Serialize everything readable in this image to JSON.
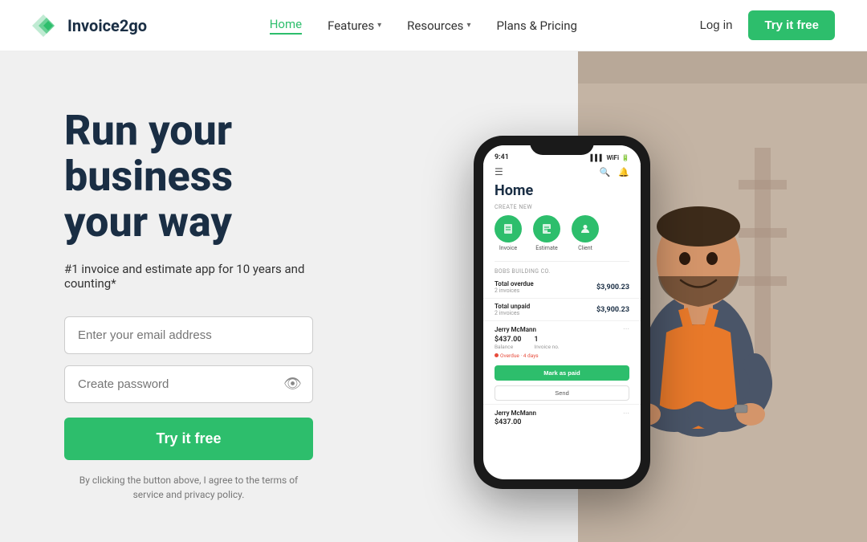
{
  "header": {
    "logo_text": "Invoice2go",
    "nav": {
      "home": "Home",
      "features": "Features",
      "resources": "Resources",
      "plans_pricing": "Plans & Pricing",
      "login": "Log in",
      "try_free": "Try it free"
    }
  },
  "hero": {
    "headline_line1": "Run your",
    "headline_line2": "business",
    "headline_line3": "your way",
    "subtitle": "#1 invoice and estimate app for 10 years and counting*",
    "email_placeholder": "Enter your email address",
    "password_placeholder": "Create password",
    "cta_button": "Try it free",
    "terms": "By clicking the button above, I agree to the terms of service and privacy policy."
  },
  "phone": {
    "status_time": "9:41",
    "home_title": "Home",
    "create_new_label": "CREATE NEW",
    "icons": [
      {
        "label": "Invoice"
      },
      {
        "label": "Estimate"
      },
      {
        "label": "Client"
      }
    ],
    "business_label": "BOBS BUILDING CO.",
    "stats": [
      {
        "title": "Total overdue",
        "sub": "2 invoices",
        "amount": "$3,900.23"
      },
      {
        "title": "Total unpaid",
        "sub": "2 invoices",
        "amount": "$3,900.23"
      }
    ],
    "clients": [
      {
        "name": "Jerry McMann",
        "balance": "$437.00",
        "balance_label": "Balance",
        "invoice_count": "1",
        "invoice_label": "Invoice no.",
        "overdue": "Overdue · 4 days",
        "mark_paid": "Mark as paid",
        "send": "Send"
      },
      {
        "name": "Jerry McMann",
        "balance": "$437.00"
      }
    ]
  },
  "icons": {
    "invoice": "📄",
    "estimate": "📋",
    "client": "👤",
    "eye": "👁",
    "hamburger": "☰",
    "search": "🔍",
    "bell": "🔔",
    "logo_arrow": "▶"
  }
}
